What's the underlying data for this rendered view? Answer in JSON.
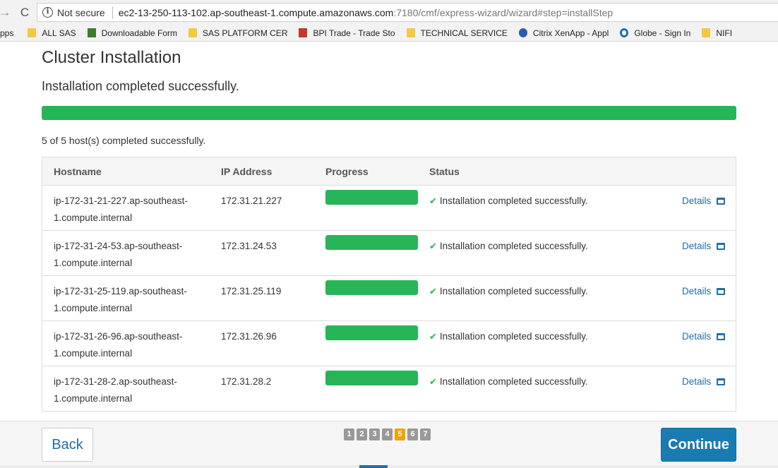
{
  "browser": {
    "back_glyph": "→",
    "reload_glyph": "C",
    "security_label": "Not secure",
    "url_host": "ec2-13-250-113-102.ap-southeast-1.compute.amazonaws.com",
    "url_rest": ":7180/cmf/express-wizard/wizard#step=installStep",
    "bookmarks": [
      {
        "label": "Apps",
        "icon": "apps-icon"
      },
      {
        "label": "ALL SAS",
        "icon": "folder-icon"
      },
      {
        "label": "Downloadable Form",
        "icon": "green-app-icon"
      },
      {
        "label": "SAS PLATFORM CER",
        "icon": "folder-icon"
      },
      {
        "label": "BPI Trade - Trade Sto",
        "icon": "red-app-icon"
      },
      {
        "label": "TECHNICAL SERVICE",
        "icon": "folder-icon"
      },
      {
        "label": "Citrix XenApp - Appl",
        "icon": "citrix-icon"
      },
      {
        "label": "Globe - Sign In",
        "icon": "globe-icon"
      },
      {
        "label": "NIFI",
        "icon": "folder-icon"
      }
    ]
  },
  "page": {
    "title": "Cluster Installation",
    "summary": "Installation completed successfully.",
    "overall_progress": 1.0,
    "hosts_count": "5 of 5 host(s) completed successfully."
  },
  "table": {
    "headers": {
      "hostname": "Hostname",
      "ip": "IP Address",
      "progress": "Progress",
      "status": "Status"
    },
    "rows": [
      {
        "host_line1": "ip-172-31-21-227.ap-southeast-",
        "host_line2": "1.compute.internal",
        "ip": "172.31.21.227",
        "progress": 1.0,
        "status": "Installation completed successfully.",
        "details": "Details"
      },
      {
        "host_line1": "ip-172-31-24-53.ap-southeast-",
        "host_line2": "1.compute.internal",
        "ip": "172.31.24.53",
        "progress": 1.0,
        "status": "Installation completed successfully.",
        "details": "Details"
      },
      {
        "host_line1": "ip-172-31-25-119.ap-southeast-",
        "host_line2": "1.compute.internal",
        "ip": "172.31.25.119",
        "progress": 1.0,
        "status": "Installation completed successfully.",
        "details": "Details"
      },
      {
        "host_line1": "ip-172-31-26-96.ap-southeast-",
        "host_line2": "1.compute.internal",
        "ip": "172.31.26.96",
        "progress": 1.0,
        "status": "Installation completed successfully.",
        "details": "Details"
      },
      {
        "host_line1": "ip-172-31-28-2.ap-southeast-",
        "host_line2": "1.compute.internal",
        "ip": "172.31.28.2",
        "progress": 1.0,
        "status": "Installation completed successfully.",
        "details": "Details"
      }
    ]
  },
  "footer": {
    "back_label": "Back",
    "continue_label": "Continue",
    "steps": [
      "1",
      "2",
      "3",
      "4",
      "5",
      "6",
      "7"
    ],
    "active_step": "5"
  },
  "colors": {
    "success_green": "#27b557",
    "link_blue": "#1f6ea8",
    "primary_button": "#1a7bb2",
    "active_step": "#f0a30a"
  }
}
